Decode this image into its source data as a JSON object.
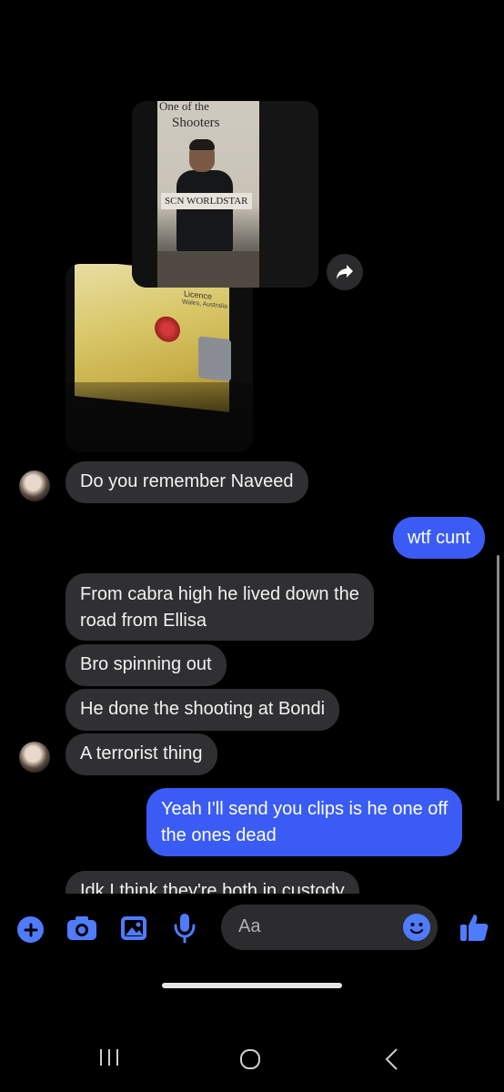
{
  "images": {
    "photo1": {
      "caption_top": "One of the",
      "caption_main": "Shooters",
      "tag": "SCN WORLDSTAR"
    },
    "photo2": {
      "card_word": "Licence",
      "card_state": "Wales, Australia"
    }
  },
  "messages": [
    {
      "from": "them",
      "text": "Do you remember Naveed"
    },
    {
      "from": "me",
      "text": "wtf cunt"
    },
    {
      "from": "them",
      "lines": [
        "From cabra high he lived down the",
        "road from Ellisa"
      ]
    },
    {
      "from": "them",
      "text": "Bro spinning out"
    },
    {
      "from": "them",
      "text": "He done the shooting at Bondi"
    },
    {
      "from": "them",
      "text": "A terrorist thing"
    },
    {
      "from": "me",
      "lines": [
        "Yeah I'll send you clips is he one off",
        "the ones dead"
      ]
    },
    {
      "from": "them",
      "text": "Idk I think they're both in custody"
    }
  ],
  "composer": {
    "placeholder": "Aa",
    "icons": [
      "plus-icon",
      "camera-icon",
      "gallery-icon",
      "microphone-icon",
      "emoji-icon",
      "thumbs-up-icon"
    ],
    "accent": "#3a5cf5"
  },
  "colors": {
    "outgoing_bubble": "#3a5cf5",
    "incoming_bubble": "#303033",
    "background": "#000000",
    "icon_accent": "#4f7cff"
  }
}
